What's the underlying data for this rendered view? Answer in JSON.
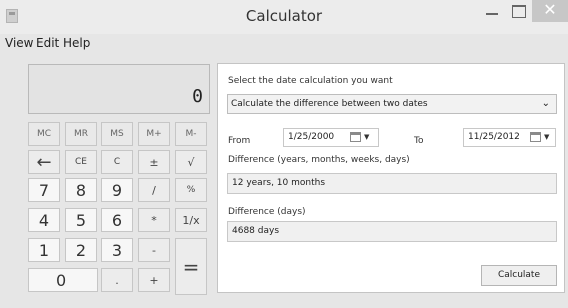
{
  "window": {
    "title": "Calculator",
    "close_glyph": "✕"
  },
  "menu": [
    "View",
    "Edit",
    "Help"
  ],
  "display": {
    "value": "0"
  },
  "keys": {
    "memory": [
      "MC",
      "MR",
      "MS",
      "M+",
      "M-"
    ],
    "row2": [
      "←",
      "CE",
      "C",
      "±",
      "√"
    ],
    "row3": [
      "7",
      "8",
      "9",
      "/",
      "%"
    ],
    "row4": [
      "4",
      "5",
      "6",
      "*",
      "1/x"
    ],
    "row5": [
      "1",
      "2",
      "3",
      "-"
    ],
    "row6": [
      "0",
      ".",
      "+"
    ],
    "equals": "="
  },
  "date_panel": {
    "prompt": "Select the date calculation you want",
    "mode": "Calculate the difference between two dates",
    "from_label": "From",
    "from_date": "1/25/2000",
    "to_label": "To",
    "to_date": "11/25/2012",
    "diff_ymwd_label": "Difference (years, months, weeks, days)",
    "diff_ymwd_value": "12 years, 10 months",
    "diff_days_label": "Difference (days)",
    "diff_days_value": "4688 days",
    "calculate_label": "Calculate"
  }
}
